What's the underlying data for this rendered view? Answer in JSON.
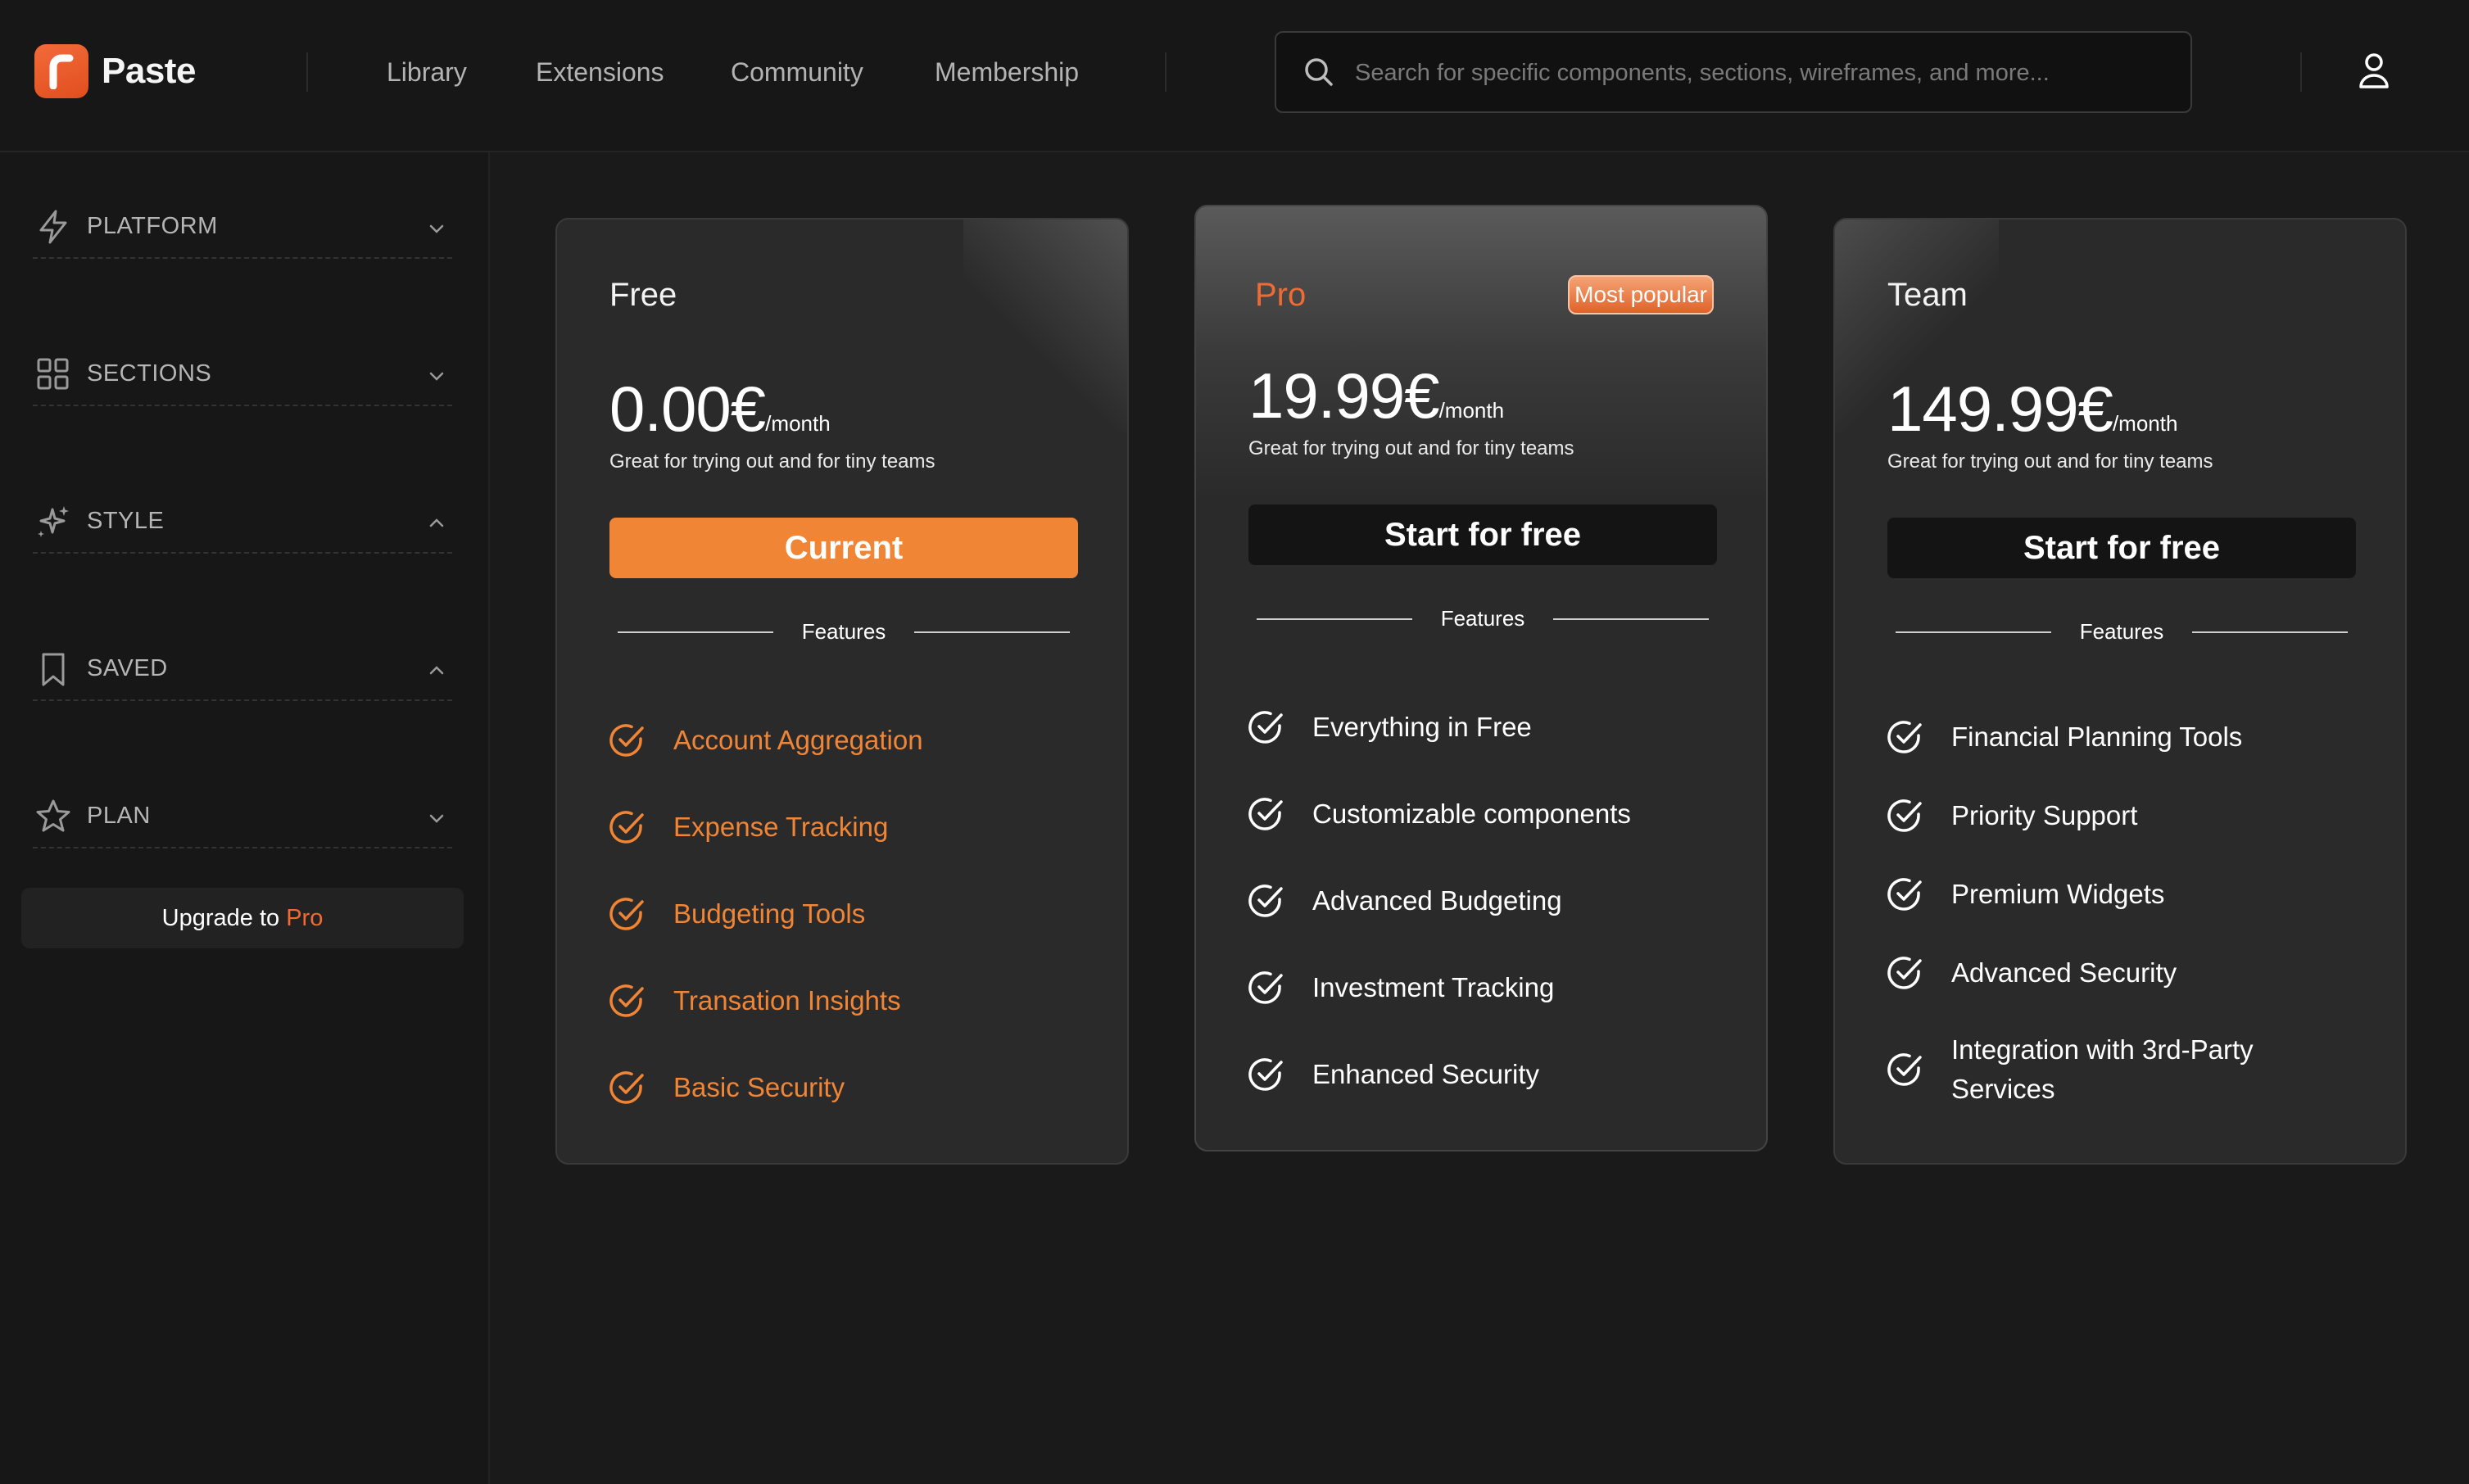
{
  "app": {
    "name": "Paste"
  },
  "nav": {
    "items": [
      "Library",
      "Extensions",
      "Community",
      "Membership"
    ]
  },
  "search": {
    "placeholder": "Search for specific components, sections, wireframes, and more..."
  },
  "sidebar": {
    "items": [
      {
        "label": "PLATFORM",
        "icon": "bolt-icon",
        "chevron": "down"
      },
      {
        "label": "SECTIONS",
        "icon": "grid-icon",
        "chevron": "down"
      },
      {
        "label": "STYLE",
        "icon": "sparkle-icon",
        "chevron": "up"
      },
      {
        "label": "SAVED",
        "icon": "bookmark-icon",
        "chevron": "up"
      },
      {
        "label": "PLAN",
        "icon": "star-icon",
        "chevron": "down"
      }
    ],
    "upgrade": {
      "prefix": "Upgrade to ",
      "highlight": "Pro"
    }
  },
  "plans": [
    {
      "name": "Free",
      "price": "0.00€",
      "period": "/month",
      "tagline": "Great for trying out and for tiny teams",
      "cta": "Current",
      "features_label": "Features",
      "features": [
        "Account Aggregation",
        "Expense Tracking",
        "Budgeting Tools",
        "Transation Insights",
        "Basic Security"
      ]
    },
    {
      "name": "Pro",
      "badge": "Most popular",
      "price": "19.99€",
      "period": "/month",
      "tagline": "Great for trying out and for tiny teams",
      "cta": "Start for free",
      "features_label": "Features",
      "features": [
        "Everything in Free",
        "Customizable components",
        "Advanced Budgeting",
        "Investment Tracking",
        "Enhanced Security"
      ]
    },
    {
      "name": "Team",
      "price": "149.99€",
      "period": "/month",
      "tagline": "Great for trying out and for tiny teams",
      "cta": "Start for free",
      "features_label": "Features",
      "features": [
        "Financial Planning Tools",
        "Priority Support",
        "Premium Widgets",
        "Advanced Security",
        "Integration with 3rd-Party Services"
      ]
    }
  ],
  "colors": {
    "accent": "#f08536",
    "brand": "#e95a28",
    "background": "#1a1a1a",
    "card": "#2a2a2a"
  }
}
